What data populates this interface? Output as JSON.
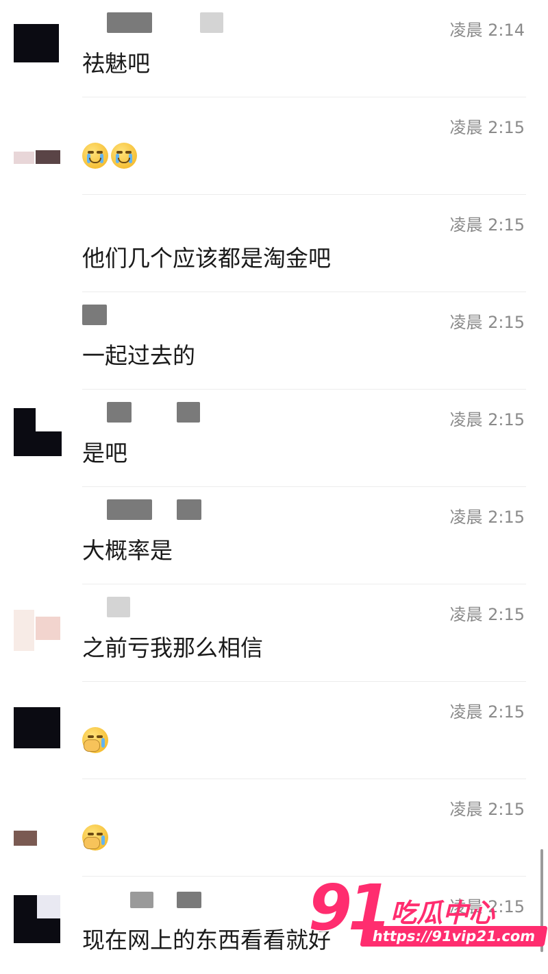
{
  "messages": [
    {
      "time": "凌晨 2:14",
      "text": "祛魅吧"
    },
    {
      "time": "凌晨 2:15",
      "emoji": [
        "crying-face-icon",
        "crying-face-icon"
      ]
    },
    {
      "time": "凌晨 2:15",
      "text": "他们几个应该都是淘金吧"
    },
    {
      "time": "凌晨 2:15",
      "text": "一起过去的"
    },
    {
      "time": "凌晨 2:15",
      "text": "是吧"
    },
    {
      "time": "凌晨 2:15",
      "text": "大概率是"
    },
    {
      "time": "凌晨 2:15",
      "text": "之前亏我那么相信"
    },
    {
      "time": "凌晨 2:15",
      "emoji": [
        "facepalm-icon"
      ]
    },
    {
      "time": "凌晨 2:15",
      "emoji": [
        "facepalm-icon"
      ]
    },
    {
      "time": "凌晨 2:15",
      "text": "现在网上的东西看看就好"
    }
  ],
  "watermark": {
    "number": "91",
    "brand": "吃瓜中心",
    "url": "https://91vip21.com"
  },
  "colors": {
    "timestamp": "#8a8a8a",
    "message_text": "#1a1a1a",
    "separator": "#ececec",
    "watermark": "#ff2d6f"
  }
}
